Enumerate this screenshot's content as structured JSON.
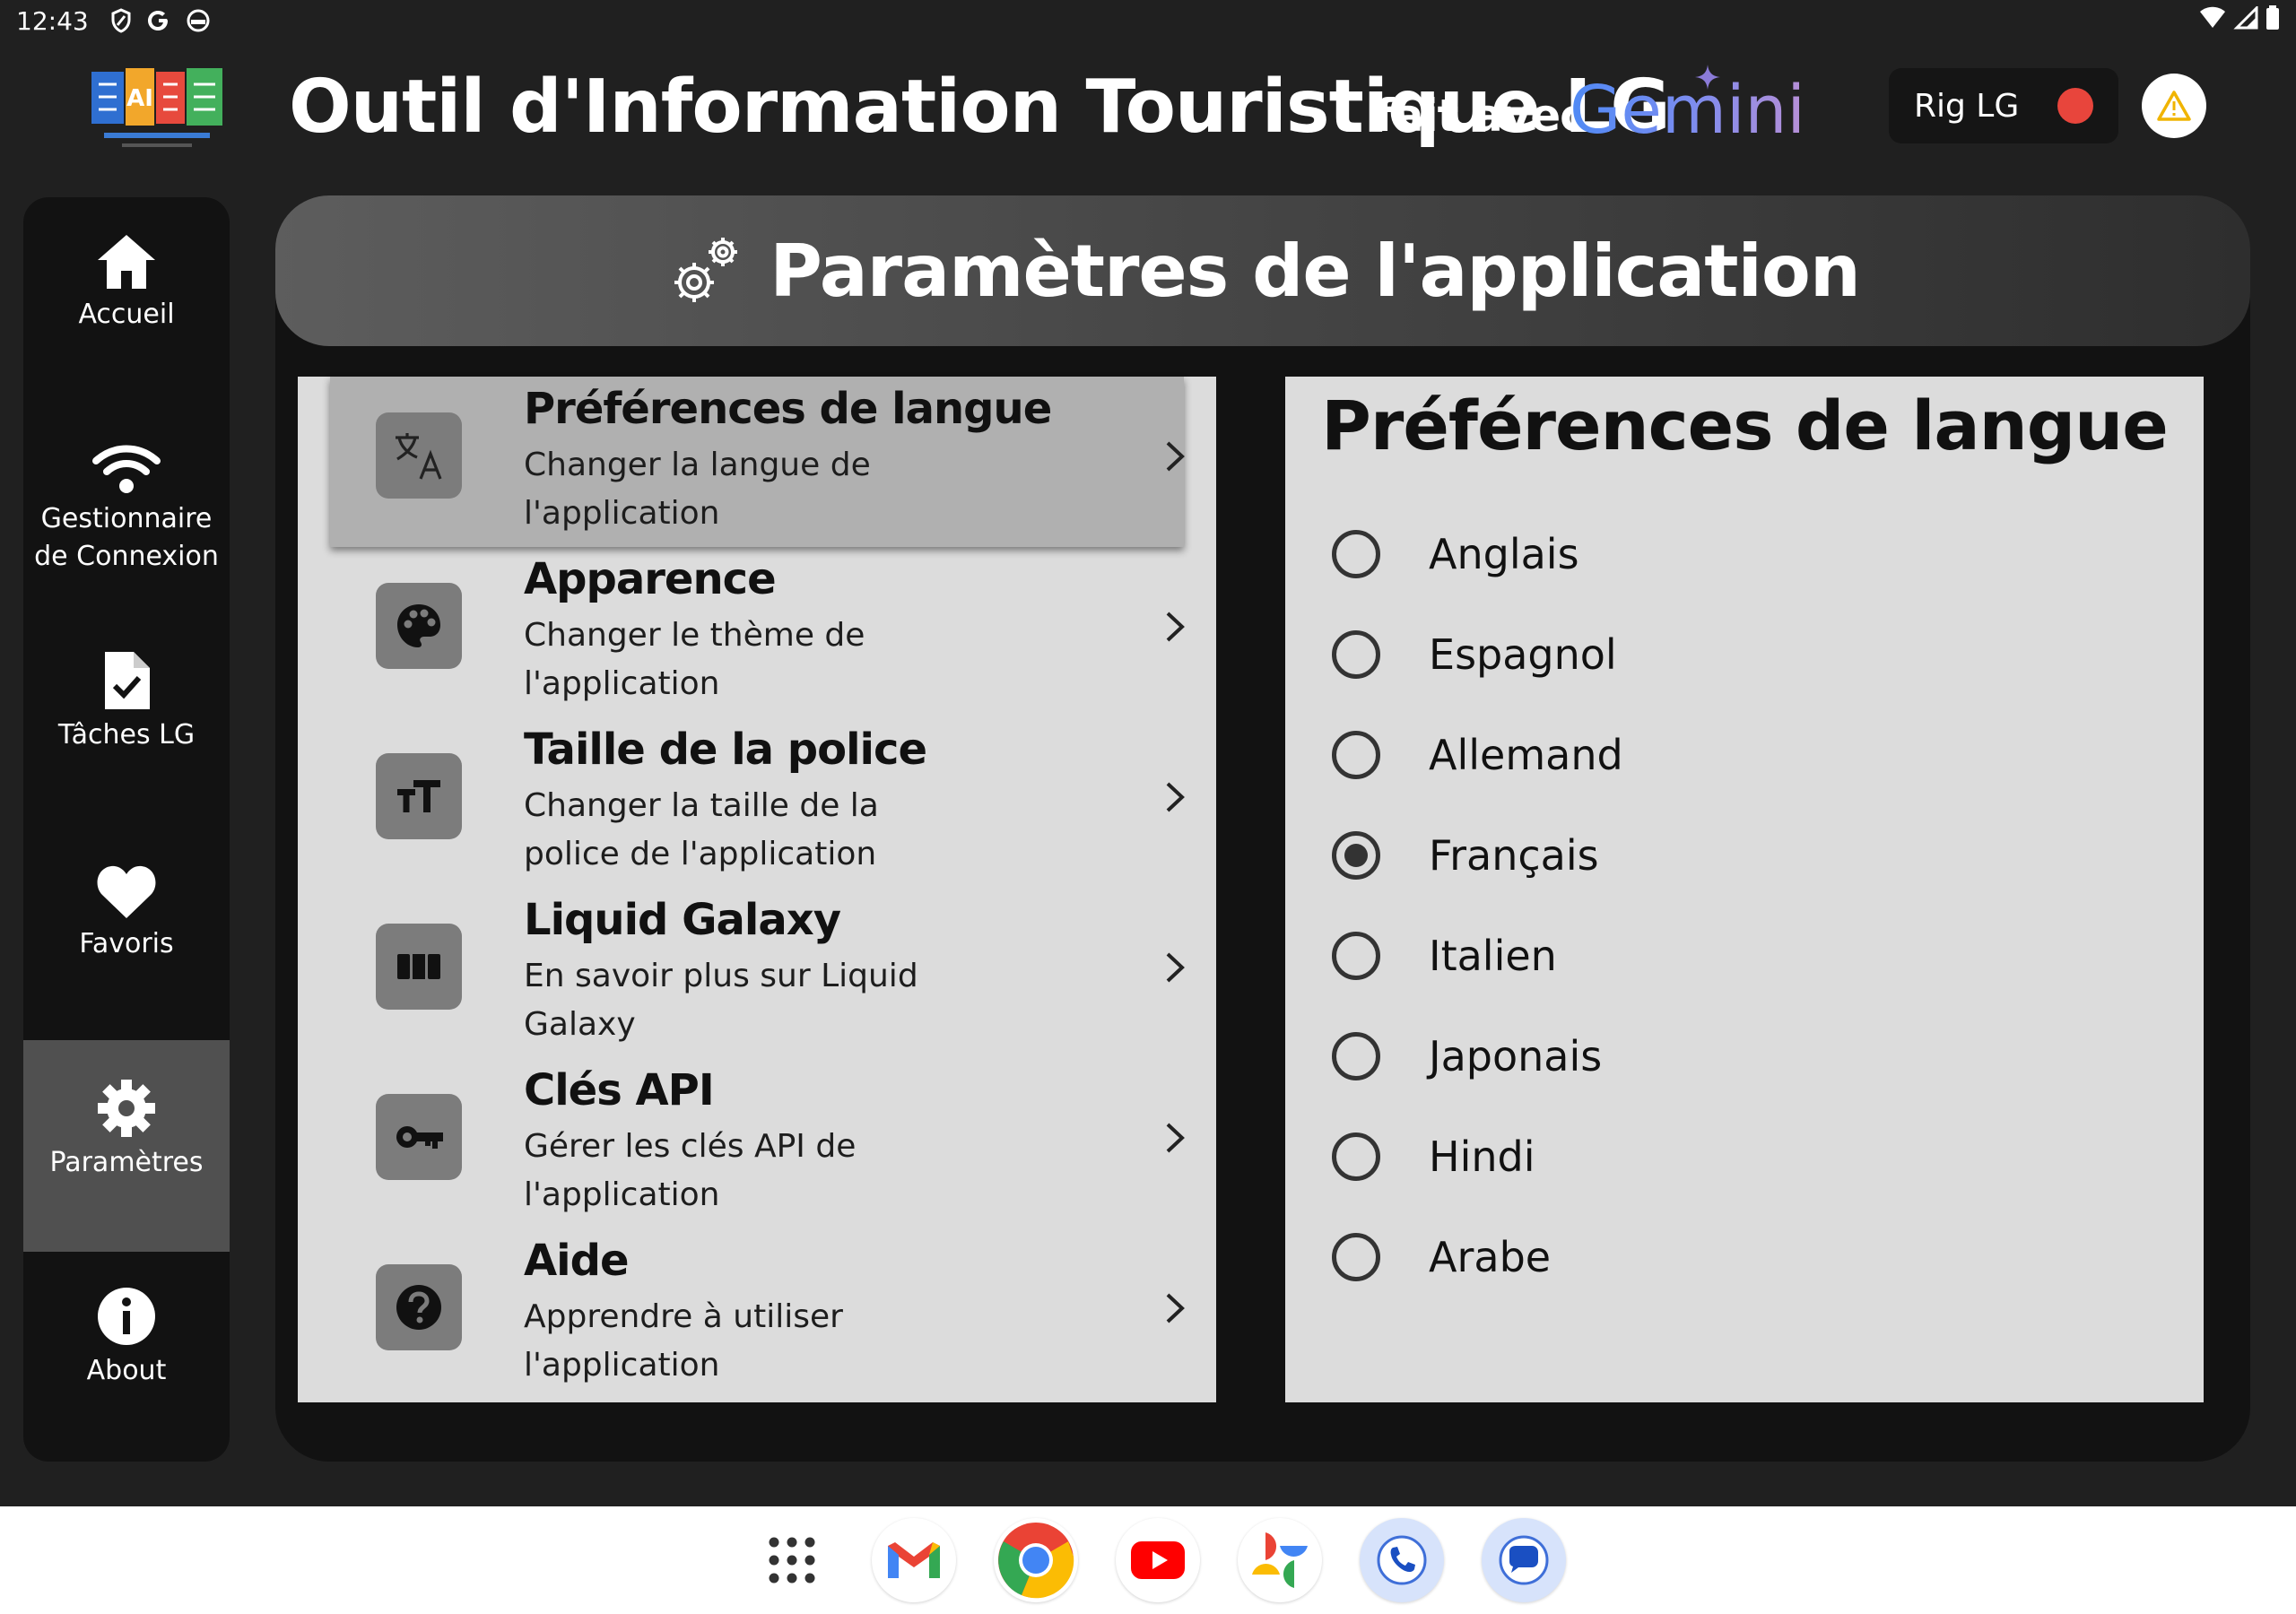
{
  "status_bar": {
    "time": "12:43"
  },
  "header": {
    "app_title": "Outil d'Information Touristique LG",
    "made_with": "fait avec",
    "gemini": "Gemini",
    "rig_label": "Rig LG",
    "rig_status_color": "#e8453c"
  },
  "sidebar": {
    "items": [
      {
        "label": "Accueil",
        "icon": "home-icon"
      },
      {
        "label": "Gestionnaire de Connexion",
        "icon": "wifi-icon"
      },
      {
        "label": "Tâches LG",
        "icon": "task-file-icon"
      },
      {
        "label": "Favoris",
        "icon": "heart-icon"
      },
      {
        "label": "Paramètres",
        "icon": "gear-icon",
        "active": true
      },
      {
        "label": "About",
        "icon": "info-icon"
      }
    ]
  },
  "main": {
    "title": "Paramètres de l'application",
    "settings": [
      {
        "title": "Préférences de langue",
        "subtitle": "Changer la langue de l'application",
        "icon": "translate-icon",
        "selected": true
      },
      {
        "title": "Apparence",
        "subtitle": "Changer le thème de l'application",
        "icon": "palette-icon"
      },
      {
        "title": "Taille de la police",
        "subtitle": "Changer la taille de la police de l'application",
        "icon": "font-size-icon"
      },
      {
        "title": "Liquid Galaxy",
        "subtitle": "En savoir plus sur Liquid Galaxy",
        "icon": "columns-icon"
      },
      {
        "title": "Clés API",
        "subtitle": "Gérer les clés API de l'application",
        "icon": "key-icon"
      },
      {
        "title": "Aide",
        "subtitle": "Apprendre à utiliser l'application",
        "icon": "help-icon"
      }
    ],
    "language_panel": {
      "title": "Préférences de langue",
      "options": [
        "Anglais",
        "Espagnol",
        "Allemand",
        "Français",
        "Italien",
        "Japonais",
        "Hindi",
        "Arabe"
      ],
      "selected": "Français"
    }
  },
  "taskbar": {
    "apps": [
      "app-drawer",
      "gmail",
      "chrome",
      "youtube",
      "photos",
      "phone",
      "messages"
    ]
  },
  "colors": {
    "background": "#202020",
    "sidebar": "#121212",
    "sidebar_active": "#505050",
    "panel": "#dcdcdc",
    "selected_row": "#b0b0b0",
    "icon_tile": "#7c7c7c"
  }
}
